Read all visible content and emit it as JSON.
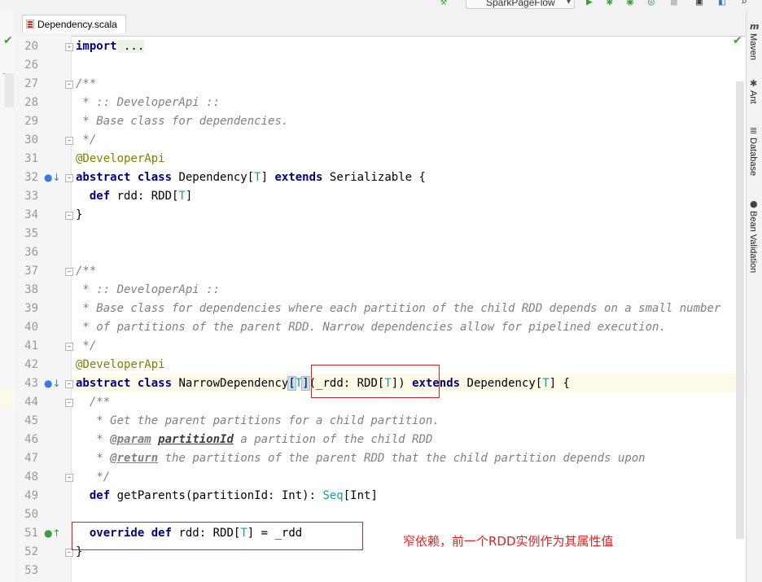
{
  "toolbar": {
    "run_config": "SparkPageFlow"
  },
  "tab": {
    "filename": "Dependency.scala"
  },
  "right_tools": [
    "Maven",
    "Ant",
    "Database",
    "Bean Validation"
  ],
  "editor": {
    "line_numbers": [
      "20",
      "26",
      "27",
      "28",
      "29",
      "30",
      "31",
      "32",
      "33",
      "34",
      "35",
      "36",
      "37",
      "38",
      "39",
      "40",
      "41",
      "42",
      "43",
      "44",
      "45",
      "46",
      "47",
      "48",
      "49",
      "50",
      "51",
      "52",
      "53"
    ],
    "lines": {
      "l20_kw": "import",
      "l20_rest": " ...",
      "l27": "/**",
      "l28": " * :: DeveloperApi ::",
      "l29": " * Base class for dependencies.",
      "l30": " */",
      "l31": "@DeveloperApi",
      "l32_kw1": "abstract class",
      "l32_a": " Dependency[",
      "l32_t": "T",
      "l32_b": "] ",
      "l32_kw2": "extends",
      "l32_c": " Serializable {",
      "l33_kw": "def",
      "l33_a": " rdd: RDD[",
      "l33_t": "T",
      "l33_b": "]",
      "l34": "}",
      "l37": "/**",
      "l38": " * :: DeveloperApi ::",
      "l39": " * Base class for dependencies where each partition of the child RDD depends on a small number",
      "l40": " * of partitions of the parent RDD. Narrow dependencies allow for pipelined execution.",
      "l41": " */",
      "l42": "@DeveloperApi",
      "l43_kw1": "abstract class",
      "l43_a": " NarrowDependency",
      "l43_lb": "[",
      "l43_t1": "T",
      "l43_rb": "]",
      "l43_b": "(_rdd: RDD[",
      "l43_t2": "T",
      "l43_c": "]) ",
      "l43_kw2": "extends",
      "l43_d": " Dependency[",
      "l43_t3": "T",
      "l43_e": "] {",
      "l44": "/**",
      "l45": " * Get the parent partitions for a child partition.",
      "l46_tag": "@param",
      "l46_name": "partitionId",
      "l46_text": " a partition of the child RDD",
      "l47_tag": "@return",
      "l47_text": " the partitions of the parent RDD that the child partition depends upon",
      "l48": " */",
      "l49_kw": "def",
      "l49_a": " getParents(partitionId: Int): ",
      "l49_seq": "Seq",
      "l49_b": "[Int]",
      "l51_kw": "override def",
      "l51_a": " rdd: RDD[",
      "l51_t": "T",
      "l51_b": "] = _rdd",
      "l52": "}"
    }
  },
  "annotation": {
    "note": "窄依赖，前一个RDD实例作为其属性值",
    "color": "#e02020"
  }
}
